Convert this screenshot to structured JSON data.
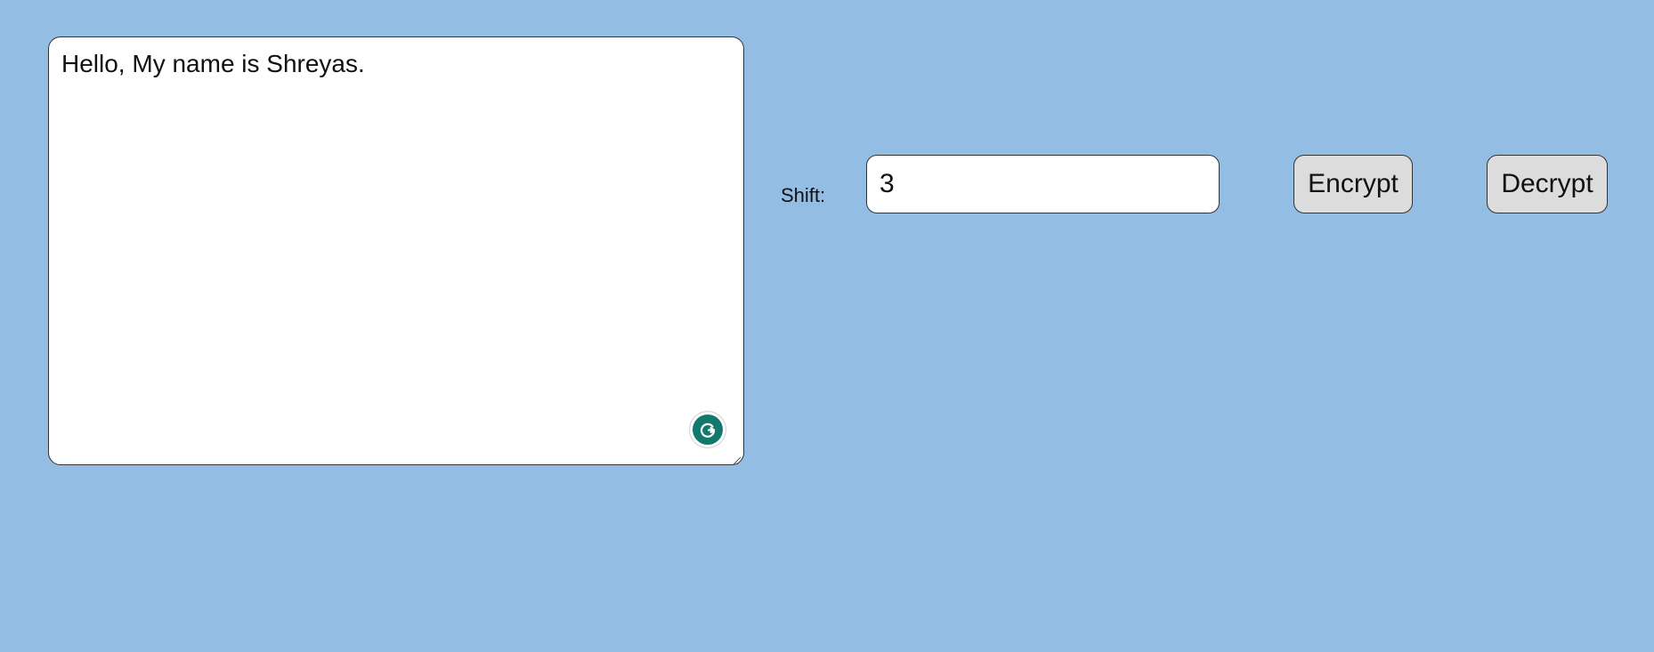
{
  "editor": {
    "text": "Hello, My name is Shreyas.",
    "grammar_icon": "grammarly-badge-icon",
    "resize_icon": "resize-grip-icon"
  },
  "controls": {
    "shift_label": "Shift:",
    "shift_value": "3",
    "encrypt_label": "Encrypt",
    "decrypt_label": "Decrypt"
  },
  "colors": {
    "background": "#93bde3",
    "grammar_badge": "#117a6c",
    "button_bg": "#dcdcdc"
  }
}
